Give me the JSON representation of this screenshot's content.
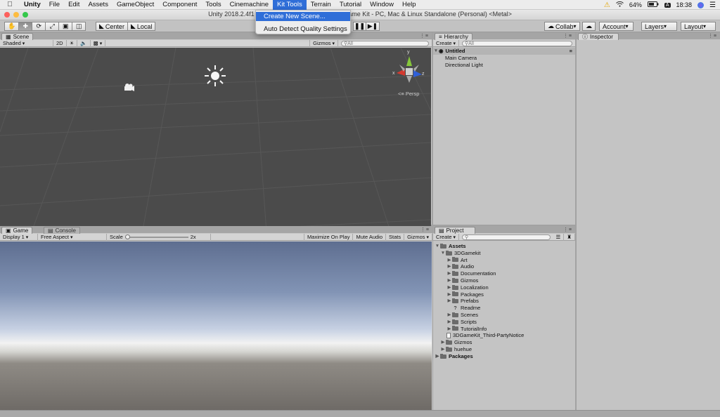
{
  "menubar": {
    "app": "Unity",
    "items": [
      "File",
      "Edit",
      "Assets",
      "GameObject",
      "Component",
      "Tools",
      "Cinemachine",
      "Kit Tools",
      "Terrain",
      "Tutorial",
      "Window",
      "Help"
    ],
    "active_item": "Kit Tools",
    "battery": "64%",
    "clock": "18:38"
  },
  "window_title": "Unity 2018.2.4f1 Personal (64bit) - Untitled - 3D Game Kit - PC, Mac & Linux Standalone (Personal) <Metal>",
  "kit_menu": {
    "options": [
      "Create New Scene...",
      "Auto Detect Quality Settings"
    ],
    "highlighted": 0
  },
  "toolbar": {
    "tools": [
      "hand-icon",
      "move-icon",
      "rotate-icon",
      "scale-icon",
      "rect-icon",
      "transform-icon"
    ],
    "pivot_mode": "Center",
    "pivot_rotation": "Local",
    "collab": "Collab",
    "account": "Account",
    "layers": "Layers",
    "layout": "Layout"
  },
  "scene": {
    "tab": "Scene",
    "shading": "Shaded",
    "mode_2d": "2D",
    "gizmos": "Gizmos",
    "search_placeholder": "All",
    "persp_label": "Persp",
    "axis_y": "y",
    "axis_x": "x",
    "axis_z": "z"
  },
  "game": {
    "tab": "Game",
    "console_tab": "Console",
    "display": "Display 1",
    "aspect": "Free Aspect",
    "scale_label": "Scale",
    "scale_value": "2x",
    "maximize": "Maximize On Play",
    "mute": "Mute Audio",
    "stats": "Stats",
    "gizmos": "Gizmos"
  },
  "hierarchy": {
    "tab": "Hierarchy",
    "create": "Create",
    "search_placeholder": "All",
    "scene_name": "Untitled",
    "items": [
      "Main Camera",
      "Directional Light"
    ]
  },
  "inspector": {
    "tab": "Inspector"
  },
  "project": {
    "tab": "Project",
    "create": "Create",
    "root": "Assets",
    "gamekit": "3DGamekit",
    "gamekit_children": [
      {
        "name": "Art",
        "type": "folder"
      },
      {
        "name": "Audio",
        "type": "folder"
      },
      {
        "name": "Documentation",
        "type": "folder"
      },
      {
        "name": "Gizmos",
        "type": "folder"
      },
      {
        "name": "Localization",
        "type": "folder"
      },
      {
        "name": "Packages",
        "type": "folder"
      },
      {
        "name": "Prefabs",
        "type": "folder"
      },
      {
        "name": "Readme",
        "type": "readme"
      },
      {
        "name": "Scenes",
        "type": "folder"
      },
      {
        "name": "Scripts",
        "type": "folder"
      },
      {
        "name": "TutorialInfo",
        "type": "folder"
      }
    ],
    "notice_file": "3DGameKit_Third-PartyNotice",
    "assets_gizmos": "Gizmos",
    "assets_huehue": "huehue",
    "packages": "Packages"
  },
  "colors": {
    "menu_highlight": "#2f6ed8",
    "scene_bg": "#4b4b4b",
    "axis_y": "#86c83a",
    "axis_x": "#d43a30",
    "axis_z": "#2f5fd8"
  }
}
